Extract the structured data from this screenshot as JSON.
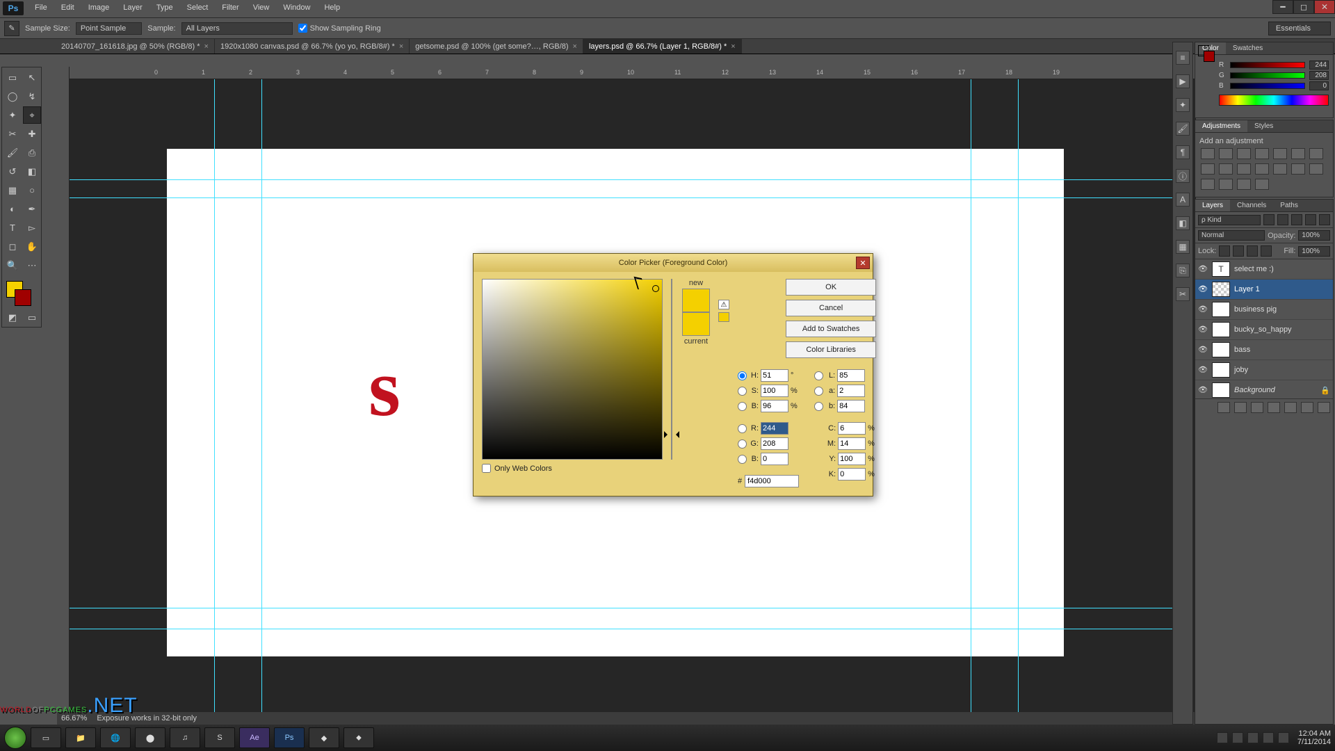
{
  "app": {
    "logo": "Ps"
  },
  "menu": [
    "File",
    "Edit",
    "Image",
    "Layer",
    "Type",
    "Select",
    "Filter",
    "View",
    "Window",
    "Help"
  ],
  "options": {
    "sample_size_label": "Sample Size:",
    "sample_size_value": "Point Sample",
    "sample_label": "Sample:",
    "sample_value": "All Layers",
    "show_ring_label": "Show Sampling Ring",
    "workspace": "Essentials"
  },
  "tabs": [
    {
      "label": "20140707_161618.jpg @ 50% (RGB/8) *",
      "active": false
    },
    {
      "label": "1920x1080 canvas.psd @ 66.7% (yo yo, RGB/8#) *",
      "active": false
    },
    {
      "label": "getsome.psd @ 100% (get some?…, RGB/8)",
      "active": false
    },
    {
      "label": "layers.psd @ 66.7% (Layer 1, RGB/8#) *",
      "active": true
    }
  ],
  "ruler_ticks": [
    "0",
    "1",
    "2",
    "3",
    "4",
    "5",
    "6",
    "7",
    "8",
    "9",
    "10",
    "11",
    "12",
    "13",
    "14",
    "15",
    "16",
    "17",
    "18",
    "19"
  ],
  "status": {
    "zoom": "66.67%",
    "hint": "Exposure works in 32-bit only"
  },
  "color_panel": {
    "tab1": "Color",
    "tab2": "Swatches",
    "r_label": "R",
    "g_label": "G",
    "b_label": "B",
    "r": "244",
    "g": "208",
    "b": "0",
    "fg": "#f4d000"
  },
  "adjustments": {
    "tab1": "Adjustments",
    "tab2": "Styles",
    "add_label": "Add an adjustment"
  },
  "layers": {
    "tab1": "Layers",
    "tab2": "Channels",
    "tab3": "Paths",
    "kind_label": "ρ Kind",
    "blend": "Normal",
    "opacity_label": "Opacity:",
    "opacity": "100%",
    "lock_label": "Lock:",
    "fill_label": "Fill:",
    "fill": "100%",
    "items": [
      {
        "name": "select me :)",
        "type": "T"
      },
      {
        "name": "Layer 1",
        "type": "img",
        "selected": true
      },
      {
        "name": "business pig",
        "type": "img"
      },
      {
        "name": "bucky_so_happy",
        "type": "img"
      },
      {
        "name": "bass",
        "type": "img"
      },
      {
        "name": "joby",
        "type": "img"
      },
      {
        "name": "Background",
        "type": "bg",
        "locked": true
      }
    ]
  },
  "dialog": {
    "title": "Color Picker (Foreground Color)",
    "new_label": "new",
    "current_label": "current",
    "ok": "OK",
    "cancel": "Cancel",
    "add": "Add to Swatches",
    "lib": "Color Libraries",
    "H": {
      "l": "H:",
      "v": "51",
      "u": "°"
    },
    "S": {
      "l": "S:",
      "v": "100",
      "u": "%"
    },
    "Bh": {
      "l": "B:",
      "v": "96",
      "u": "%"
    },
    "R": {
      "l": "R:",
      "v": "244"
    },
    "G": {
      "l": "G:",
      "v": "208"
    },
    "Bb": {
      "l": "B:",
      "v": "0"
    },
    "L": {
      "l": "L:",
      "v": "85"
    },
    "a": {
      "l": "a:",
      "v": "2"
    },
    "b": {
      "l": "b:",
      "v": "84"
    },
    "C": {
      "l": "C:",
      "v": "6",
      "u": "%"
    },
    "M": {
      "l": "M:",
      "v": "14",
      "u": "%"
    },
    "Y": {
      "l": "Y:",
      "v": "100",
      "u": "%"
    },
    "K": {
      "l": "K:",
      "v": "0",
      "u": "%"
    },
    "hex_label": "#",
    "hex": "f4d000",
    "webonly": "Only Web Colors",
    "new_color": "#f4d000",
    "current_color": "#f4d000"
  },
  "taskbar": {
    "apps": [
      "⊞",
      "▭",
      "📁",
      "🌐",
      "⬤",
      "♫",
      "S",
      "Ae",
      "Ps",
      "◆",
      "⬥"
    ],
    "time": "12:04 AM",
    "date": "7/11/2014"
  },
  "watermark": {
    "a": "WORLD",
    "b": "OF",
    "c": "PCGAMES",
    "d": ".NET"
  }
}
